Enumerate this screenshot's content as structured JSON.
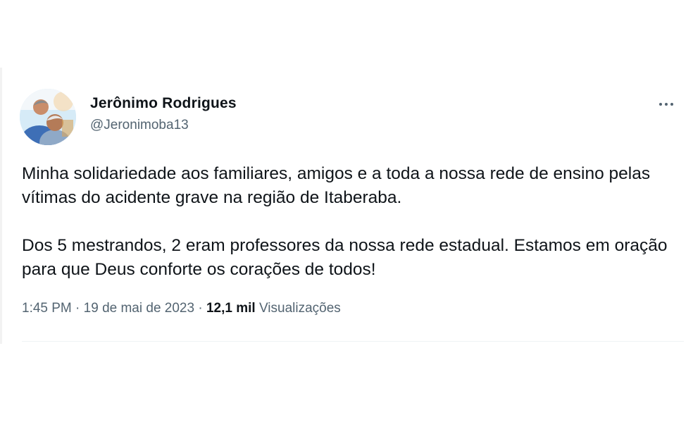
{
  "tweet": {
    "author": {
      "display_name": "Jerônimo Rodrigues",
      "handle": "@Jeronimoba13"
    },
    "more_icon": "more-horizontal-icon",
    "paragraphs": [
      "Minha solidariedade aos familiares, amigos e a toda a nossa rede de ensino pelas vítimas do acidente grave na região de Itaberaba.",
      "Dos 5 mestrandos, 2 eram professores da nossa rede estadual. Estamos em oração para que Deus conforte os corações de todos!"
    ],
    "meta": {
      "time": "1:45 PM",
      "separator1": " · ",
      "date": "19 de mai de 2023",
      "separator2": " · ",
      "views_count": "12,1 mil",
      "views_label": "Visualizações"
    },
    "colors": {
      "text": "#0f1419",
      "secondary": "#536471"
    }
  }
}
